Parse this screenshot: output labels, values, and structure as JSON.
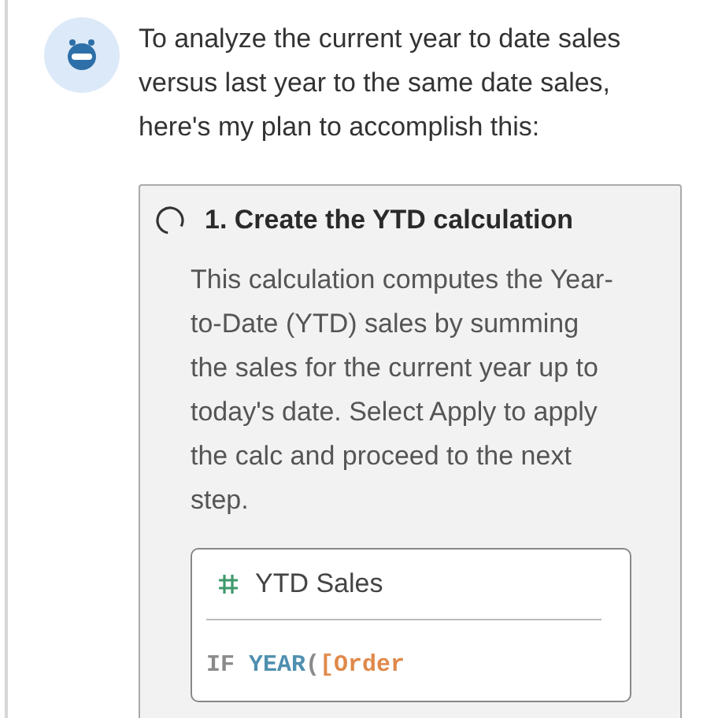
{
  "message": {
    "text": "To analyze the current year to date sales versus last year to the same date sales, here's my plan to accomplish this:"
  },
  "steps": [
    {
      "title": "1. Create the YTD calculation",
      "completed": false,
      "description": "This calculation computes the Year-to-Date (YTD) sales by summing the sales for the current year up to today's date. Select Apply to apply the calc and proceed to the next step.",
      "calculation": {
        "name": "YTD Sales",
        "code": [
          {
            "kind": "keyword",
            "text": "IF "
          },
          {
            "kind": "function",
            "text": "YEAR"
          },
          {
            "kind": "keyword",
            "text": "("
          },
          {
            "kind": "field",
            "text": "[Order"
          }
        ]
      }
    }
  ]
}
